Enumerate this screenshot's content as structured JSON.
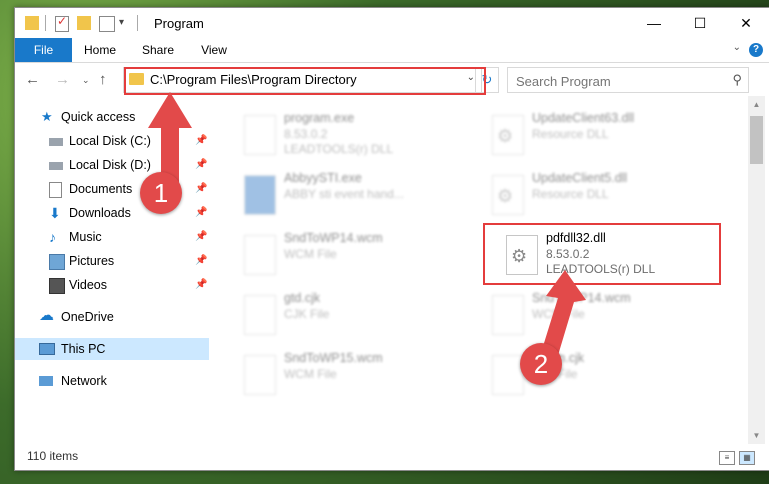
{
  "window": {
    "title": "Program",
    "minimize": "—",
    "maximize": "☐",
    "close": "✕"
  },
  "ribbon": {
    "tabs": [
      "File",
      "Home",
      "Share",
      "View"
    ],
    "help": "?"
  },
  "nav": {
    "address": "C:\\Program Files\\Program Directory",
    "search_placeholder": "Search Program"
  },
  "sidebar": {
    "items": [
      {
        "label": "Quick access",
        "icon": "star-icon"
      },
      {
        "label": "Local Disk (C:)",
        "icon": "drive-icon"
      },
      {
        "label": "Local Disk (D:)",
        "icon": "drive-icon"
      },
      {
        "label": "Documents",
        "icon": "documents-icon"
      },
      {
        "label": "Downloads",
        "icon": "download-icon"
      },
      {
        "label": "Music",
        "icon": "music-icon"
      },
      {
        "label": "Pictures",
        "icon": "pictures-icon"
      },
      {
        "label": "Videos",
        "icon": "videos-icon"
      },
      {
        "label": "OneDrive",
        "icon": "cloud-icon"
      },
      {
        "label": "This PC",
        "icon": "computer-icon"
      },
      {
        "label": "Network",
        "icon": "network-icon"
      }
    ]
  },
  "files": [
    {
      "name": "program.exe",
      "line2": "8.53.0.2",
      "line3": "LEADTOOLS(r) DLL"
    },
    {
      "name": "UpdateClient63.dll",
      "line2": "Resource DLL",
      "line3": ""
    },
    {
      "name": "AbbyySTI.exe",
      "line2": "ABBY sti event hand...",
      "line3": ""
    },
    {
      "name": "UpdateClient5.dll",
      "line2": "Resource DLL",
      "line3": ""
    },
    {
      "name": "SndToWP14.wcm",
      "line2": "WCM File",
      "line3": ""
    },
    {
      "name": "pdfdll32.dll",
      "line2": "8.53.0.2",
      "line3": "LEADTOOLS(r) DLL"
    },
    {
      "name": "gtd.cjk",
      "line2": "CJK File",
      "line3": ""
    },
    {
      "name": "SndToWP14.wcm",
      "line2": "WCM File",
      "line3": ""
    },
    {
      "name": "SndToWP15.wcm",
      "line2": "WCM File",
      "line3": ""
    },
    {
      "name": "gtdwn.cjk",
      "line2": "CJK File",
      "line3": ""
    }
  ],
  "status": {
    "count": "110 items"
  },
  "annotations": {
    "step1": "1",
    "step2": "2"
  }
}
